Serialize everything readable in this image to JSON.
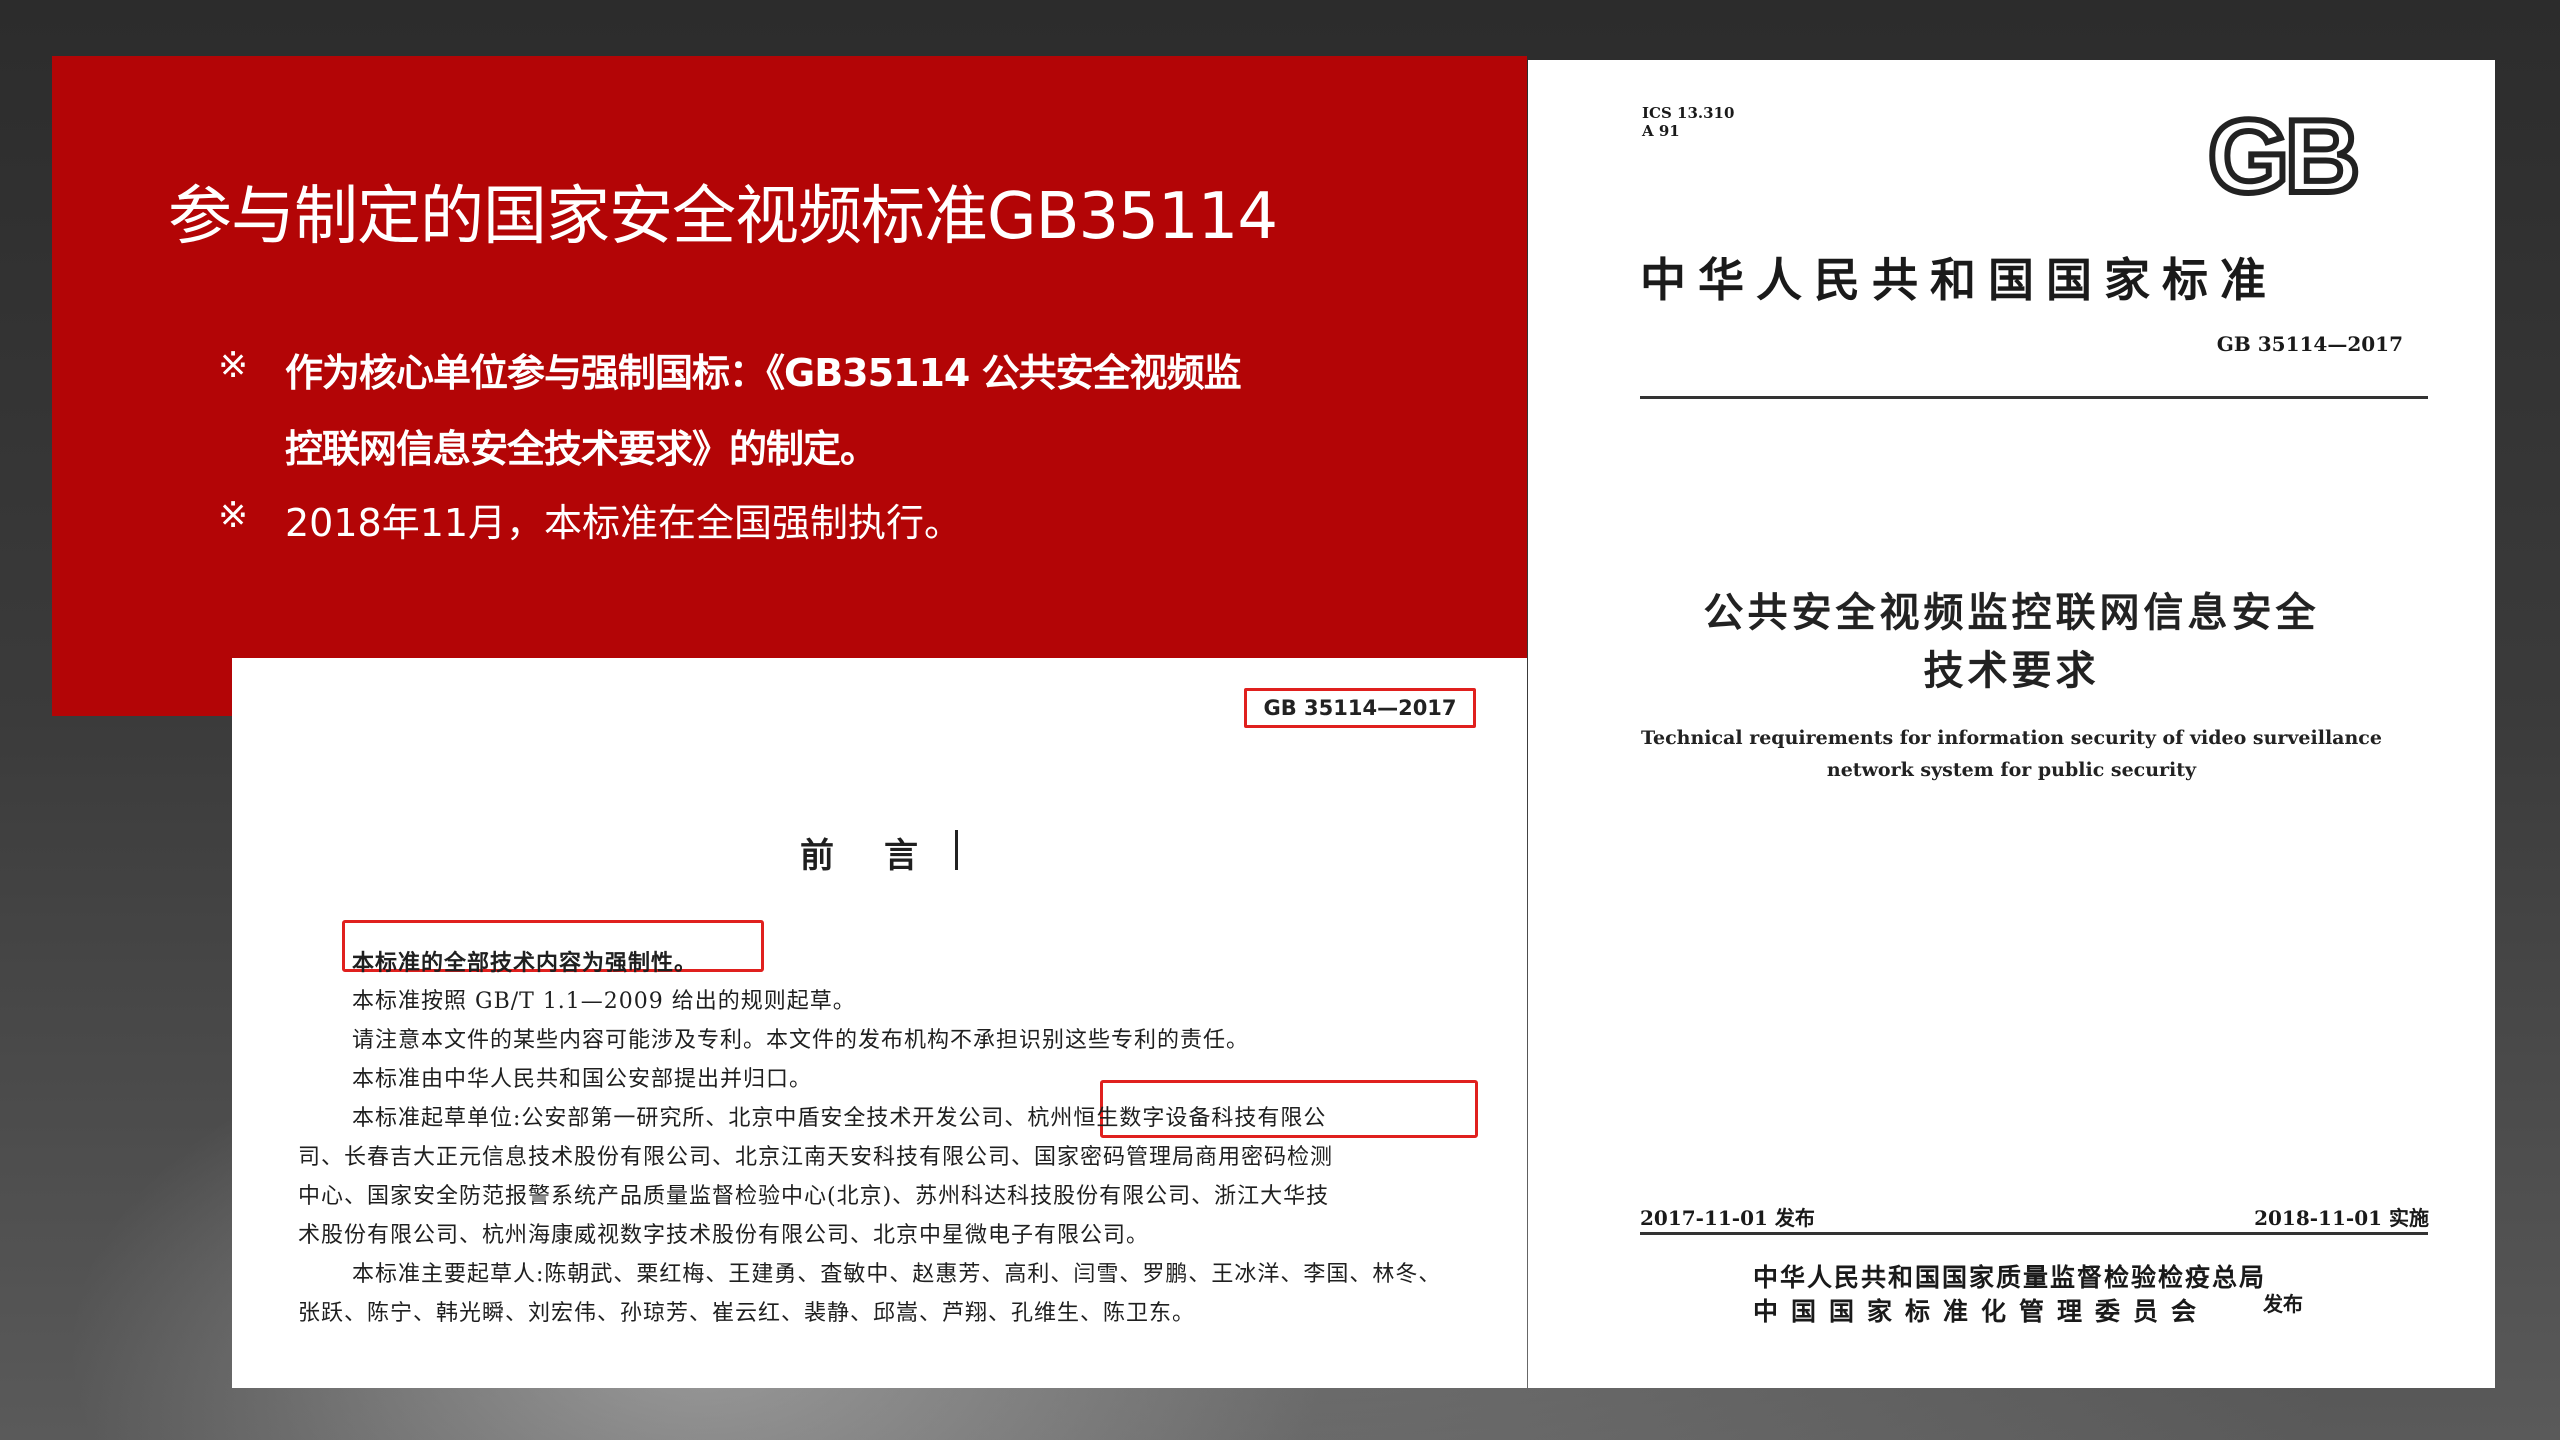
{
  "slide": {
    "title": "参与制定的国家安全视频标准GB35114",
    "bullets": [
      {
        "mark": "※",
        "lines": [
          "作为核心单位参与强制国标：《GB35114 公共安全视频监",
          "控联网信息安全技术要求》的制定。"
        ],
        "bold": true
      },
      {
        "mark": "※",
        "lines": [
          "2018年11月，本标准在全国强制执行。"
        ],
        "bold": false
      }
    ],
    "colors": {
      "accent_red": "#b30506",
      "highlight_box": "#e0201e"
    }
  },
  "cover": {
    "ics": "ICS 13.310",
    "ccs": "A 91",
    "logo": "GB",
    "national_standard": "中华人民共和国国家标准",
    "code": "GB 35114—2017",
    "title_cn_line1": "公共安全视频监控联网信息安全",
    "title_cn_line2": "技术要求",
    "title_en_line1": "Technical requirements for information security of video surveillance",
    "title_en_line2": "network system for public security",
    "release_date": "2017-11-01 发布",
    "effective_date": "2018-11-01 实施",
    "issuer_line1": "中华人民共和国国家质量监督检验检疫总局",
    "issuer_line2": "中国国家标准化管理委员会",
    "publish": "发布"
  },
  "foreword": {
    "code": "GB 35114—2017",
    "heading": "前言",
    "lines": [
      "本标准的全部技术内容为强制性。",
      "本标准按照 GB/T 1.1—2009 给出的规则起草。",
      "请注意本文件的某些内容可能涉及专利。本文件的发布机构不承担识别这些专利的责任。",
      "本标准由中华人民共和国公安部提出并归口。",
      "本标准起草单位:公安部第一研究所、北京中盾安全技术开发公司、杭州恒生数字设备科技有限公",
      "司、长春吉大正元信息技术股份有限公司、北京江南天安科技有限公司、国家密码管理局商用密码检测",
      "中心、国家安全防范报警系统产品质量监督检验中心(北京)、苏州科达科技股份有限公司、浙江大华技",
      "术股份有限公司、杭州海康威视数字技术股份有限公司、北京中星微电子有限公司。",
      "本标准主要起草人:陈朝武、栗红梅、王建勇、査敏中、赵惠芳、高利、闫雪、罗鹏、王冰洋、李国、林冬、",
      "张跃、陈宁、韩光瞬、刘宏伟、孙琼芳、崔云红、裴静、邱嵩、芦翔、孔维生、陈卫东。"
    ]
  }
}
